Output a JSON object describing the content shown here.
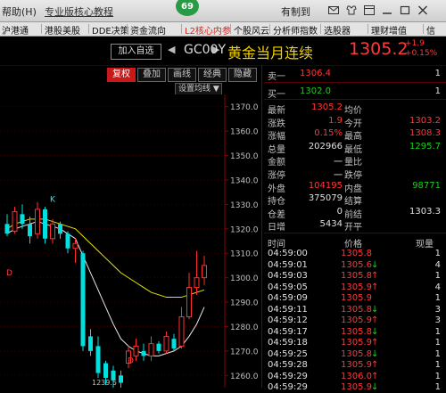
{
  "topbar": {
    "help": "帮助(H)",
    "tutorial": "专业版核心教程",
    "badge": "69",
    "login": "有制到",
    "colors": {
      "badge": "#2a9a46"
    }
  },
  "menu": {
    "items": [
      {
        "label": "沪港通",
        "red": false
      },
      {
        "label": "港股美股",
        "red": false
      },
      {
        "label": "DDE决策",
        "red": false
      },
      {
        "label": "资金流向",
        "red": false
      },
      {
        "label": "L2核心内参",
        "red": true
      },
      {
        "label": "个股风云",
        "red": false
      },
      {
        "label": "分析师指数",
        "red": false
      },
      {
        "label": "选股器",
        "red": false
      },
      {
        "label": "理财增值",
        "red": false
      },
      {
        "label": "信",
        "red": false
      }
    ]
  },
  "header": {
    "add_button": "加入自选",
    "code": "GC00Y",
    "name": "黄金当月连续",
    "price": "1305.2",
    "change": "+1.9",
    "change_pct": "+0.15%"
  },
  "toolbar": {
    "buttons": [
      "复权",
      "叠加",
      "画线",
      "经典",
      "隐藏"
    ],
    "active": "复权",
    "settings": "设置均线"
  },
  "chart_data": {
    "type": "candlestick",
    "y_ticks": [
      "1370.0",
      "1360.0",
      "1350.0",
      "1340.0",
      "1330.0",
      "1320.0",
      "1310.0",
      "1300.0",
      "1290.0",
      "1280.0",
      "1270.0",
      "1260.0"
    ],
    "ylim": [
      1255,
      1375
    ],
    "markers": [
      "K",
      "D",
      "D"
    ],
    "bottom_label": "1239.5",
    "candles": [
      {
        "o": 1322,
        "c": 1318,
        "h": 1326,
        "l": 1317
      },
      {
        "o": 1319,
        "c": 1327,
        "h": 1329,
        "l": 1318
      },
      {
        "o": 1326,
        "c": 1322,
        "h": 1330,
        "l": 1320
      },
      {
        "o": 1322,
        "c": 1317,
        "h": 1325,
        "l": 1314
      },
      {
        "o": 1318,
        "c": 1328,
        "h": 1331,
        "l": 1316
      },
      {
        "o": 1328,
        "c": 1316,
        "h": 1329,
        "l": 1314
      },
      {
        "o": 1316,
        "c": 1322,
        "h": 1324,
        "l": 1314
      },
      {
        "o": 1322,
        "c": 1318,
        "h": 1323,
        "l": 1316
      },
      {
        "o": 1318,
        "c": 1312,
        "h": 1319,
        "l": 1310
      },
      {
        "o": 1312,
        "c": 1314,
        "h": 1316,
        "l": 1306
      },
      {
        "o": 1310,
        "c": 1272,
        "h": 1311,
        "l": 1270
      },
      {
        "o": 1276,
        "c": 1270,
        "h": 1279,
        "l": 1268
      },
      {
        "o": 1272,
        "c": 1261,
        "h": 1276,
        "l": 1259
      },
      {
        "o": 1265,
        "c": 1259,
        "h": 1266,
        "l": 1256
      },
      {
        "o": 1262,
        "c": 1258,
        "h": 1264,
        "l": 1254
      },
      {
        "o": 1260,
        "c": 1257,
        "h": 1262,
        "l": 1252
      },
      {
        "o": 1265,
        "c": 1270,
        "h": 1272,
        "l": 1263
      },
      {
        "o": 1268,
        "c": 1272,
        "h": 1275,
        "l": 1266
      },
      {
        "o": 1270,
        "c": 1268,
        "h": 1273,
        "l": 1266
      },
      {
        "o": 1268,
        "c": 1273,
        "h": 1276,
        "l": 1266
      },
      {
        "o": 1273,
        "c": 1270,
        "h": 1274,
        "l": 1269
      },
      {
        "o": 1270,
        "c": 1276,
        "h": 1278,
        "l": 1269
      },
      {
        "o": 1275,
        "c": 1271,
        "h": 1277,
        "l": 1270
      },
      {
        "o": 1272,
        "c": 1284,
        "h": 1288,
        "l": 1271
      },
      {
        "o": 1284,
        "c": 1296,
        "h": 1302,
        "l": 1283
      },
      {
        "o": 1296,
        "c": 1300,
        "h": 1311,
        "l": 1293
      },
      {
        "o": 1300,
        "c": 1305,
        "h": 1309,
        "l": 1297
      }
    ],
    "ma1": [
      1318,
      1320,
      1321,
      1322,
      1323,
      1322,
      1321,
      1320,
      1318,
      1316,
      1309,
      1302,
      1295,
      1288,
      1281,
      1275,
      1272,
      1270,
      1269,
      1268,
      1268,
      1269,
      1270,
      1272,
      1276,
      1281,
      1288
    ],
    "ma2": [
      1320,
      1322,
      1323,
      1324,
      1324,
      1324,
      1323,
      1322,
      1321,
      1320,
      1317,
      1314,
      1311,
      1308,
      1305,
      1302,
      1300,
      1298,
      1296,
      1294,
      1293,
      1292,
      1292,
      1292,
      1293,
      1294,
      1295
    ]
  },
  "panel": {
    "sell": {
      "label": "卖一",
      "price": "1306.4",
      "vol": "1"
    },
    "buy": {
      "label": "买一",
      "price": "1302.0",
      "vol": "1"
    },
    "rows": [
      {
        "l1": "最新",
        "v1": "1305.2",
        "l2": "均价",
        "v2": "",
        "c1": "red",
        "c2": "wht"
      },
      {
        "l1": "涨跌",
        "v1": "1.9",
        "l2": "今开",
        "v2": "1303.2",
        "c1": "red",
        "c2": "red"
      },
      {
        "l1": "涨幅",
        "v1": "0.15%",
        "l2": "最高",
        "v2": "1308.3",
        "c1": "red",
        "c2": "red"
      },
      {
        "l1": "总量",
        "v1": "202966",
        "l2": "最低",
        "v2": "1295.7",
        "c1": "wht",
        "c2": "green"
      },
      {
        "l1": "金额",
        "v1": "一",
        "l2": "量比",
        "v2": "",
        "c1": "wht",
        "c2": "wht"
      },
      {
        "l1": "涨停",
        "v1": "一",
        "l2": "跌停",
        "v2": "",
        "c1": "wht",
        "c2": "wht"
      },
      {
        "l1": "外盘",
        "v1": "104195",
        "l2": "内盘",
        "v2": "98771",
        "c1": "red",
        "c2": "green"
      },
      {
        "l1": "持仓",
        "v1": "375079",
        "l2": "结算",
        "v2": "",
        "c1": "wht",
        "c2": "wht"
      },
      {
        "l1": "仓差",
        "v1": "0",
        "l2": "前结",
        "v2": "1303.3",
        "c1": "wht",
        "c2": "wht"
      },
      {
        "l1": "日增",
        "v1": "5434",
        "l2": "开平",
        "v2": "",
        "c1": "wht",
        "c2": "wht"
      }
    ],
    "ticks_header": [
      "时间",
      "价格",
      "现量"
    ],
    "ticks": [
      {
        "t": "04:59:00",
        "p": "1305.8",
        "a": "",
        "v": "1",
        "c": "red"
      },
      {
        "t": "04:59:01",
        "p": "1305.6",
        "a": "↓",
        "v": "4",
        "c": "red"
      },
      {
        "t": "04:59:03",
        "p": "1305.8",
        "a": "↑",
        "v": "1",
        "c": "red"
      },
      {
        "t": "04:59:05",
        "p": "1305.9",
        "a": "↑",
        "v": "4",
        "c": "red"
      },
      {
        "t": "04:59:09",
        "p": "1305.9",
        "a": "",
        "v": "1",
        "c": "red"
      },
      {
        "t": "04:59:11",
        "p": "1305.8",
        "a": "↓",
        "v": "3",
        "c": "red"
      },
      {
        "t": "04:59:12",
        "p": "1305.9",
        "a": "↑",
        "v": "3",
        "c": "red"
      },
      {
        "t": "04:59:17",
        "p": "1305.8",
        "a": "↓",
        "v": "1",
        "c": "red"
      },
      {
        "t": "04:59:18",
        "p": "1305.9",
        "a": "↑",
        "v": "1",
        "c": "red"
      },
      {
        "t": "04:59:25",
        "p": "1305.8",
        "a": "↓",
        "v": "1",
        "c": "red"
      },
      {
        "t": "04:59:28",
        "p": "1305.9",
        "a": "↑",
        "v": "1",
        "c": "red"
      },
      {
        "t": "04:59:29",
        "p": "1306.0",
        "a": "↑",
        "v": "1",
        "c": "red"
      },
      {
        "t": "04:59:29",
        "p": "1305.9",
        "a": "↓",
        "v": "1",
        "c": "red"
      }
    ]
  }
}
